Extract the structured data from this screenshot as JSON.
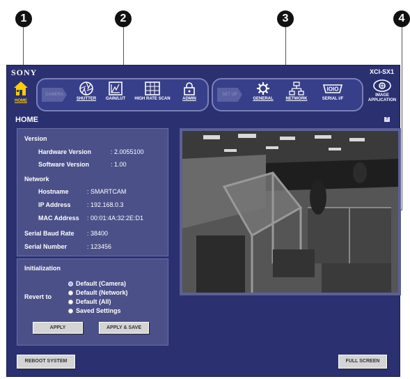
{
  "callouts": [
    "1",
    "2",
    "3",
    "4"
  ],
  "header": {
    "brand": "SONY",
    "model": "XCI-SX1"
  },
  "toolbar": {
    "home_label": "HOME",
    "camera_tag": "CAMERA",
    "shutter_label": "SHUTTER",
    "gain_label": "GAIN/LUT",
    "hrs_label": "HIGH RATE SCAN",
    "admin_label": "ADMIN",
    "setup_tag": "SET UP",
    "general_label": "GENERAL",
    "network_label": "NETWORK",
    "serial_label": "SERIAL I/F",
    "image_app_line1": "IMAGE",
    "image_app_line2": "APPLICATION"
  },
  "page": {
    "title": "HOME",
    "help": "?"
  },
  "info": {
    "version_heading": "Version",
    "hw_label": "Hardware Version",
    "hw_value": ": 2.0055100",
    "sw_label": "Software Version",
    "sw_value": ": 1.00",
    "network_heading": "Network",
    "host_label": "Hostname",
    "host_value": ": SMARTCAM",
    "ip_label": "IP Address",
    "ip_value": ": 192.168.0.3",
    "mac_label": "MAC Address",
    "mac_value": ": 00:01:4A:32:2E:D1",
    "baud_label": "Serial Baud Rate",
    "baud_value": ": 38400",
    "serial_label": "Serial Number",
    "serial_value": ": 123456"
  },
  "init": {
    "heading": "Initialization",
    "revert_label": "Revert to",
    "options": [
      "Default (Camera)",
      "Default (Network)",
      "Default (All)",
      "Saved Settings"
    ],
    "apply": "APPLY",
    "apply_save": "APPLY & SAVE"
  },
  "footer": {
    "reboot": "REBOOT SYSTEM",
    "fullscreen": "FULL SCREEN"
  },
  "colors": {
    "frame": "#2a3070",
    "panel": "#4b5089",
    "home_accent": "#ffcc00"
  }
}
